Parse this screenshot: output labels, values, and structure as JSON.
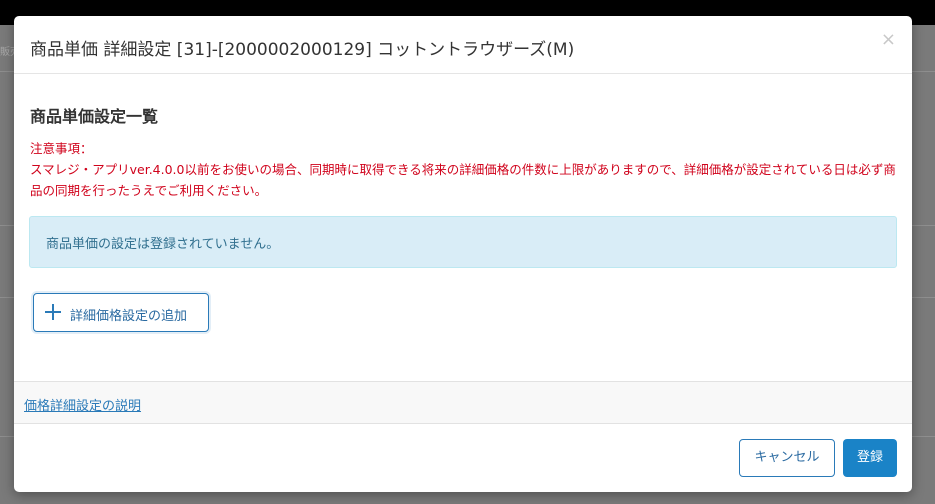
{
  "background": {
    "tab_label": "販売"
  },
  "modal": {
    "title": "商品単価 詳細設定 [31]-[2000002000129] コットントラウザーズ(M)",
    "close_icon": "×"
  },
  "section": {
    "title": "商品単価設定一覧"
  },
  "notice": {
    "heading": "注意事項：",
    "body": "スマレジ・アプリver.4.0.0以前をお使いの場合、同期時に取得できる将来の詳細価格の件数に上限がありますので、詳細価格が設定されている日は必ず商品の同期を行ったうえでご利用ください。"
  },
  "alert": {
    "message": "商品単価の設定は登録されていません。"
  },
  "add_button": {
    "icon": "plus-icon",
    "label": "詳細価格設定の追加"
  },
  "help_link": {
    "label": "価格詳細設定の説明"
  },
  "footer": {
    "cancel_label": "キャンセル",
    "save_label": "登録"
  },
  "colors": {
    "primary": "#1a83c7",
    "warning_text": "#d0021b",
    "alert_bg": "#d9edf7",
    "alert_text": "#31708f"
  }
}
